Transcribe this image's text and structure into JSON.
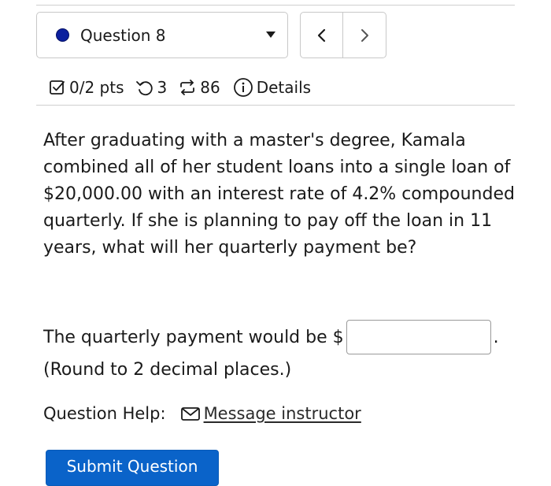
{
  "question_nav": {
    "current_label": "Question 8",
    "status_color": "#0b1f9e",
    "prev_label": "<",
    "next_label": ">"
  },
  "meta": {
    "points": "0/2 pts",
    "attempts": "3",
    "submissions": "86",
    "details_label": "Details",
    "icons": [
      "checkbox-icon",
      "retry-icon",
      "repeat-icon",
      "info-icon"
    ]
  },
  "question": {
    "text": "After graduating with a master's degree, Kamala combined all of her student loans into a single loan of $20,000.00 with an interest rate of 4.2% compounded quarterly. If she is planning to pay off the loan in 11 years, what will her quarterly payment be?",
    "answer_prefix": "The quarterly payment would be $",
    "answer_value": "",
    "answer_suffix": ".",
    "round_note": "(Round to 2 decimal places.)"
  },
  "help": {
    "label": "Question Help:",
    "message_link": "Message instructor"
  },
  "submit": {
    "label": "Submit Question",
    "color": "#0a63c9"
  }
}
